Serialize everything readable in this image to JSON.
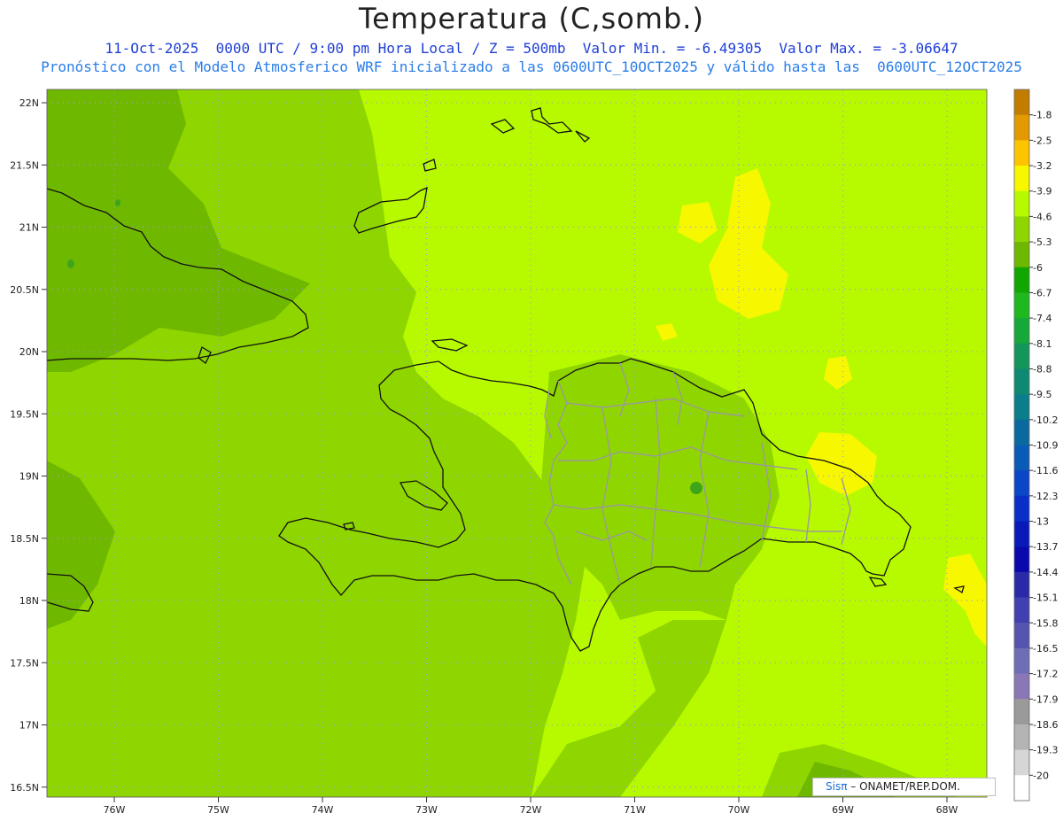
{
  "header": {
    "title": "Temperatura (C,somb.)",
    "subtitle1": "11-Oct-2025  0000 UTC / 9:00 pm Hora Local / Z = 500mb  Valor Min. = -6.49305  Valor Max. = -3.06647",
    "subtitle2": "Pronóstico con el Modelo Atmosferico WRF inicializado a las 0600UTC_10OCT2025 y válido hasta las  0600UTC_12OCT2025"
  },
  "axes": {
    "lat_labels": [
      "22N",
      "21.5N",
      "21N",
      "20.5N",
      "20N",
      "19.5N",
      "19N",
      "18.5N",
      "18N",
      "17.5N",
      "17N",
      "16.5N"
    ],
    "lat_values": [
      22,
      21.5,
      21,
      20.5,
      20,
      19.5,
      19,
      18.5,
      18,
      17.5,
      17,
      16.5
    ],
    "lon_labels": [
      "76W",
      "75W",
      "74W",
      "73W",
      "72W",
      "71W",
      "70W",
      "69W",
      "68W"
    ],
    "lon_values": [
      -76,
      -75,
      -74,
      -73,
      -72,
      -71,
      -70,
      -69,
      -68
    ]
  },
  "colorbar": {
    "labels": [
      "-1.8",
      "-2.5",
      "-3.2",
      "-3.9",
      "-4.6",
      "-5.3",
      "-6",
      "-6.7",
      "-7.4",
      "-8.1",
      "-8.8",
      "-9.5",
      "-10.2",
      "-10.9",
      "-11.6",
      "-12.3",
      "-13",
      "-13.7",
      "-14.4",
      "-15.1",
      "-15.8",
      "-16.5",
      "-17.2",
      "-17.9",
      "-18.6",
      "-19.3",
      "-20"
    ],
    "colors": [
      "#c27c00",
      "#e29a00",
      "#ffc400",
      "#f7f700",
      "#b7fa00",
      "#8fd600",
      "#6fb800",
      "#10a800",
      "#1fb81f",
      "#17a83a",
      "#13965a",
      "#0e8a72",
      "#0a7e8a",
      "#0a6aa0",
      "#0a5ab8",
      "#0a46c6",
      "#0a2fc8",
      "#0a1ab8",
      "#0a0aac",
      "#2a2aa8",
      "#4040b0",
      "#5555b0",
      "#6e6eb6",
      "#8a78b6",
      "#9a9a9a",
      "#b4b4b4",
      "#d6d6d6",
      "#ffffff"
    ]
  },
  "field_colors": {
    "base": "#b7fa00",
    "mid": "#8fd600",
    "dark": "#6fb800",
    "darkest": "#3ea51a",
    "warm": "#f7f700",
    "coast": "#111111",
    "borders": "#9a9a9a",
    "grid": "#9aa0c8"
  },
  "footer": {
    "sis": "Sisπ",
    "org": " – ONAMET/REP.DOM."
  }
}
